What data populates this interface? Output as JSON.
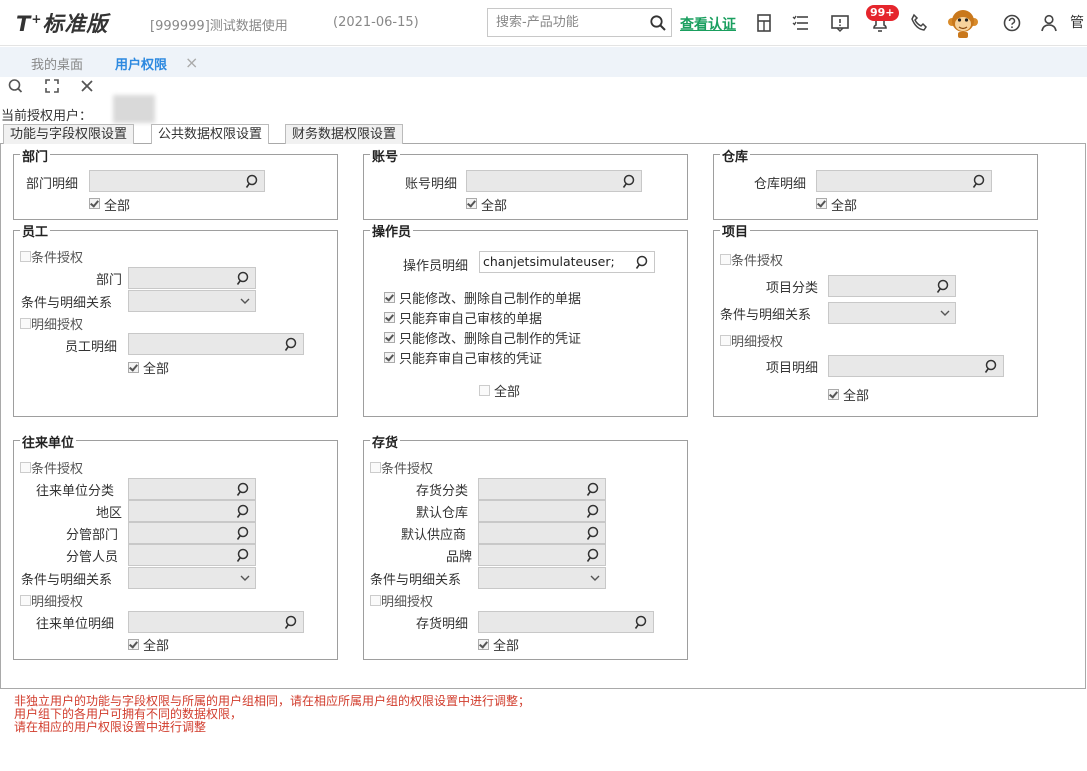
{
  "header": {
    "logo_t": "T",
    "logo_sup": "+",
    "logo_text": "标准版",
    "account": "[999999]测试数据使用",
    "date": "(2021-06-15)",
    "search_placeholder": "搜索-产品功能",
    "verify_link": "查看认证",
    "badge": "99+",
    "admin_label": "管"
  },
  "tabs": {
    "desktop": "我的桌面",
    "active": "用户权限",
    "close": "×"
  },
  "current_user_label": "当前授权用户：",
  "subtabs": [
    "功能与字段权限设置",
    "公共数据权限设置",
    "财务数据权限设置"
  ],
  "dept": {
    "title": "部门",
    "detail_label": "部门明细",
    "all_label": "全部"
  },
  "account_box": {
    "title": "账号",
    "detail_label": "账号明细",
    "all_label": "全部"
  },
  "warehouse": {
    "title": "仓库",
    "detail_label": "仓库明细",
    "all_label": "全部"
  },
  "employee": {
    "title": "员工",
    "cond_auth": "条件授权",
    "dept_label": "部门",
    "relation_label": "条件与明细关系",
    "detail_auth": "明细授权",
    "detail_label": "员工明细",
    "all_label": "全部"
  },
  "operator": {
    "title": "操作员",
    "detail_label": "操作员明细",
    "detail_value": "chanjetsimulateuser;",
    "opt1": "只能修改、删除自己制作的单据",
    "opt2": "只能弃审自己审核的单据",
    "opt3": "只能修改、删除自己制作的凭证",
    "opt4": "只能弃审自己审核的凭证",
    "all_label": "全部"
  },
  "project": {
    "title": "项目",
    "cond_auth": "条件授权",
    "category_label": "项目分类",
    "relation_label": "条件与明细关系",
    "detail_auth": "明细授权",
    "detail_label": "项目明细",
    "all_label": "全部"
  },
  "partner": {
    "title": "往来单位",
    "cond_auth": "条件授权",
    "category_label": "往来单位分类",
    "region_label": "地区",
    "dept_label": "分管部门",
    "staff_label": "分管人员",
    "relation_label": "条件与明细关系",
    "detail_auth": "明细授权",
    "detail_label": "往来单位明细",
    "all_label": "全部"
  },
  "inventory": {
    "title": "存货",
    "cond_auth": "条件授权",
    "category_label": "存货分类",
    "warehouse_label": "默认仓库",
    "supplier_label": "默认供应商",
    "brand_label": "品牌",
    "relation_label": "条件与明细关系",
    "detail_auth": "明细授权",
    "detail_label": "存货明细",
    "all_label": "全部"
  },
  "notice": {
    "line1": "非独立用户的功能与字段权限与所属的用户组相同，请在相应所属用户组的权限设置中进行调整；",
    "line2": "用户组下的各用户可拥有不同的数据权限，",
    "line3": "请在相应的用户权限设置中进行调整"
  }
}
